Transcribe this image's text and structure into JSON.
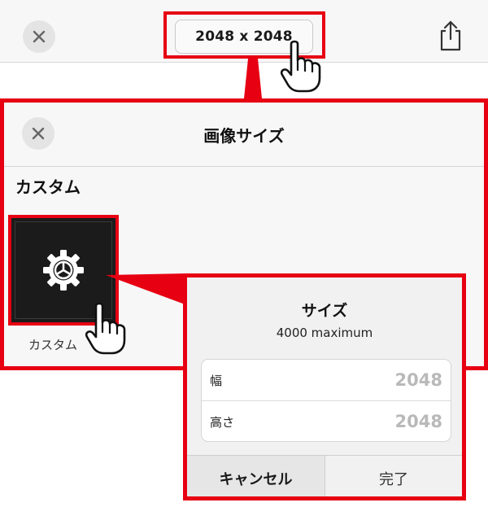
{
  "topbar": {
    "close_icon": "close-icon",
    "size_label": "2048 x 2048",
    "share_icon": "share-icon"
  },
  "image_size_panel": {
    "title": "画像サイズ",
    "close_icon": "close-icon",
    "section_title": "カスタム",
    "custom_tile": {
      "icon": "gear-icon",
      "label": "カスタム"
    }
  },
  "size_dialog": {
    "title": "サイズ",
    "subtitle": "4000 maximum",
    "width_label": "幅",
    "width_value": "2048",
    "height_label": "高さ",
    "height_value": "2048",
    "cancel_label": "キャンセル",
    "done_label": "完了"
  },
  "annotation": {
    "highlight_color": "#e60012",
    "pointer_icon": "pointing-hand-icon"
  }
}
